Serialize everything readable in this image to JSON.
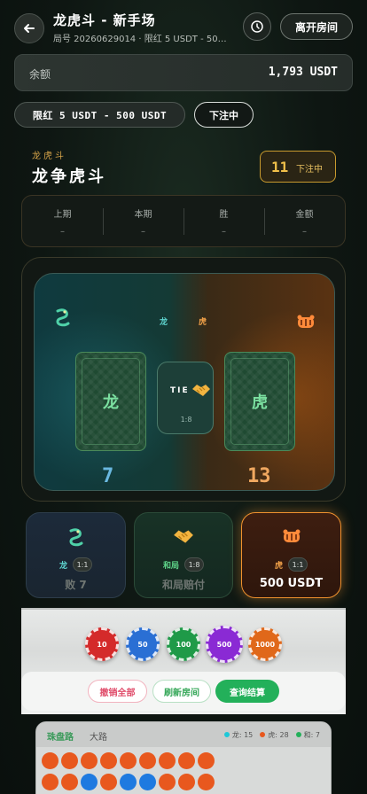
{
  "header": {
    "title": "龙虎斗 - 新手场",
    "subtitle": "局号 20260629014 · 限红 5 USDT - 500 U...",
    "leave_label": "离开房间"
  },
  "balance": {
    "label": "余额",
    "value": "1,793 USDT"
  },
  "limit_pill": "限红 5 USDT - 500 USDT",
  "status_pill": "下注中",
  "game": {
    "subtitle": "龙虎斗",
    "title": "龙争虎斗",
    "countdown": "11",
    "countdown_label": "下注中"
  },
  "stats": [
    {
      "label": "上期",
      "value": "–"
    },
    {
      "label": "本期",
      "value": "–"
    },
    {
      "label": "胜",
      "value": "–"
    },
    {
      "label": "金额",
      "value": "–"
    }
  ],
  "table": {
    "dragon_label": "龙",
    "tiger_label": "虎",
    "dragon_card": "龙",
    "tiger_card": "虎",
    "tie_text": "TIE",
    "tie_odds": "1:8",
    "dragon_score": "7",
    "tiger_score": "13"
  },
  "bets": {
    "dragon": {
      "name": "龙",
      "odds": "1:1",
      "sub": "败 7"
    },
    "tie": {
      "name": "和局",
      "odds": "1:8",
      "sub": "和局赔付"
    },
    "tiger": {
      "name": "虎",
      "odds": "1:1",
      "sub": "500 USDT"
    }
  },
  "chips": [
    {
      "label": "10",
      "color": "#d42a2a"
    },
    {
      "label": "50",
      "color": "#2a6fd4"
    },
    {
      "label": "100",
      "color": "#1f9a48"
    },
    {
      "label": "500",
      "color": "#8a2ad4"
    },
    {
      "label": "1000",
      "color": "#e0681a"
    }
  ],
  "actions": {
    "cancel": "撤销全部",
    "refresh": "刷新房间",
    "query": "查询结算"
  },
  "roadmap": {
    "tab_bead": "珠盘路",
    "tab_big": "大路",
    "legend_dragon": "龙: 15",
    "legend_tiger": "虎: 28",
    "legend_tie": "和: 7",
    "row1": [
      "r",
      "r",
      "r",
      "r",
      "r",
      "r",
      "r",
      "r",
      "r"
    ],
    "row2": [
      "r",
      "r",
      "b",
      "r",
      "b",
      "b",
      "r",
      "r",
      "r"
    ]
  }
}
